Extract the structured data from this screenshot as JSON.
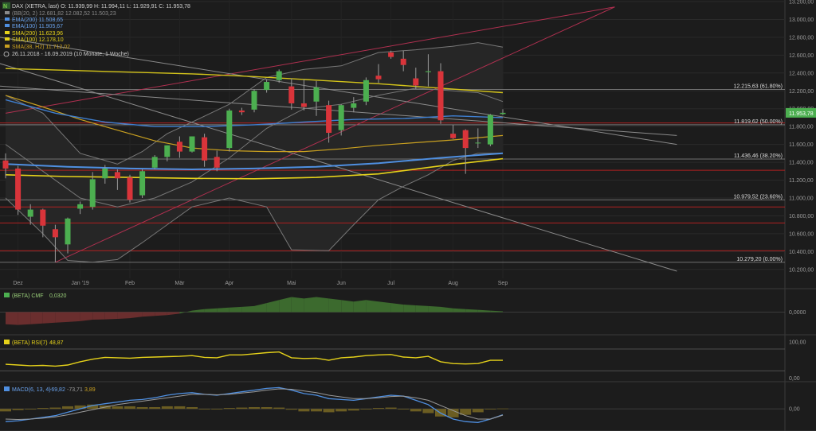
{
  "legend": {
    "title": "DAX (XETRA, last)  O: 11.939,99  H: 11.994,11  L: 11.929,91  C: 11.953,78",
    "items": [
      {
        "label": "(BB(20, 2)  12.681,82  12.082,52  11.503,23",
        "color": "#8a8a8a"
      },
      {
        "label": "EMA(200)  11.508,65",
        "color": "#4f8fe0"
      },
      {
        "label": "EMA(100)  11.905,67",
        "color": "#4f8fe0"
      },
      {
        "label": "SMA(200)  11.623,96",
        "color": "#e6d21a"
      },
      {
        "label": "SMA(100)  12.178,10",
        "color": "#e6d21a"
      },
      {
        "label": "SMA(38, H2)  11.712,02",
        "color": "#c9a020"
      }
    ],
    "period": "26.11.2018 - 16.09.2019  (10 Monate, 1 Woche)",
    "logo_text": "N"
  },
  "chart_data": [
    {
      "type": "candlestick",
      "title": "DAX (XETRA, last)",
      "ylim": [
        10100,
        13200
      ],
      "y_ticks": [
        "13.200,00",
        "13.000,00",
        "12.800,00",
        "12.600,00",
        "12.400,00",
        "12.200,00",
        "12.000,00",
        "11.800,00",
        "11.600,00",
        "11.400,00",
        "11.200,00",
        "11.000,00",
        "10.800,00",
        "10.600,00",
        "10.400,00",
        "10.200,00"
      ],
      "x_ticks": [
        {
          "label": "Dez",
          "week": 1
        },
        {
          "label": "Jan '19",
          "week": 6
        },
        {
          "label": "Feb",
          "week": 10
        },
        {
          "label": "Mär",
          "week": 14
        },
        {
          "label": "Apr",
          "week": 18
        },
        {
          "label": "Mai",
          "week": 23
        },
        {
          "label": "Jun",
          "week": 27
        },
        {
          "label": "Jul",
          "week": 31
        },
        {
          "label": "Aug",
          "week": 36
        },
        {
          "label": "Sep",
          "week": 40
        }
      ],
      "candles": [
        {
          "w": 0,
          "o": 11420,
          "h": 11500,
          "l": 11220,
          "c": 11330
        },
        {
          "w": 1,
          "o": 11330,
          "h": 11360,
          "l": 10810,
          "c": 10870
        },
        {
          "w": 2,
          "o": 10790,
          "h": 10930,
          "l": 10700,
          "c": 10870
        },
        {
          "w": 3,
          "o": 10870,
          "h": 10880,
          "l": 10560,
          "c": 10690
        },
        {
          "w": 4,
          "o": 10650,
          "h": 10700,
          "l": 10280,
          "c": 10560
        },
        {
          "w": 5,
          "o": 10480,
          "h": 10780,
          "l": 10380,
          "c": 10770
        },
        {
          "w": 6,
          "o": 10880,
          "h": 10960,
          "l": 10820,
          "c": 10930
        },
        {
          "w": 7,
          "o": 10900,
          "h": 11290,
          "l": 10870,
          "c": 11210
        },
        {
          "w": 8,
          "o": 11220,
          "h": 11370,
          "l": 11160,
          "c": 11330
        },
        {
          "w": 9,
          "o": 11290,
          "h": 11320,
          "l": 11090,
          "c": 11220
        },
        {
          "w": 10,
          "o": 11230,
          "h": 11260,
          "l": 10950,
          "c": 10980
        },
        {
          "w": 11,
          "o": 11030,
          "h": 11320,
          "l": 11000,
          "c": 11300
        },
        {
          "w": 12,
          "o": 11340,
          "h": 11480,
          "l": 11320,
          "c": 11460
        },
        {
          "w": 13,
          "o": 11460,
          "h": 11590,
          "l": 11410,
          "c": 11590
        },
        {
          "w": 14,
          "o": 11630,
          "h": 11690,
          "l": 11450,
          "c": 11520
        },
        {
          "w": 15,
          "o": 11520,
          "h": 11690,
          "l": 11510,
          "c": 11690
        },
        {
          "w": 16,
          "o": 11680,
          "h": 11720,
          "l": 11350,
          "c": 11420
        },
        {
          "w": 17,
          "o": 11460,
          "h": 11530,
          "l": 11300,
          "c": 11340
        },
        {
          "w": 18,
          "o": 11560,
          "h": 12000,
          "l": 11520,
          "c": 11980
        },
        {
          "w": 19,
          "o": 11980,
          "h": 12010,
          "l": 11930,
          "c": 11960
        },
        {
          "w": 20,
          "o": 11990,
          "h": 12220,
          "l": 11960,
          "c": 12200
        },
        {
          "w": 21,
          "o": 12210,
          "h": 12330,
          "l": 12180,
          "c": 12300
        },
        {
          "w": 22,
          "o": 12320,
          "h": 12440,
          "l": 12290,
          "c": 12420
        },
        {
          "w": 23,
          "o": 12250,
          "h": 12340,
          "l": 11990,
          "c": 12060
        },
        {
          "w": 24,
          "o": 12060,
          "h": 12330,
          "l": 11980,
          "c": 12020
        },
        {
          "w": 25,
          "o": 12080,
          "h": 12310,
          "l": 11920,
          "c": 12240
        },
        {
          "w": 26,
          "o": 12040,
          "h": 12090,
          "l": 11620,
          "c": 11730
        },
        {
          "w": 27,
          "o": 11760,
          "h": 12050,
          "l": 11700,
          "c": 12040
        },
        {
          "w": 28,
          "o": 12010,
          "h": 12130,
          "l": 11960,
          "c": 12060
        },
        {
          "w": 29,
          "o": 12080,
          "h": 12350,
          "l": 12040,
          "c": 12320
        },
        {
          "w": 30,
          "o": 12370,
          "h": 12500,
          "l": 12290,
          "c": 12330
        },
        {
          "w": 31,
          "o": 12630,
          "h": 12650,
          "l": 12560,
          "c": 12580
        },
        {
          "w": 32,
          "o": 12560,
          "h": 12650,
          "l": 12420,
          "c": 12490
        },
        {
          "w": 33,
          "o": 12340,
          "h": 12460,
          "l": 12220,
          "c": 12260
        },
        {
          "w": 34,
          "o": 12410,
          "h": 12610,
          "l": 12250,
          "c": 12420
        },
        {
          "w": 35,
          "o": 12420,
          "h": 12510,
          "l": 11830,
          "c": 11870
        },
        {
          "w": 36,
          "o": 11720,
          "h": 11820,
          "l": 11660,
          "c": 11670
        },
        {
          "w": 37,
          "o": 11760,
          "h": 11770,
          "l": 11270,
          "c": 11560
        },
        {
          "w": 38,
          "o": 11620,
          "h": 11780,
          "l": 11560,
          "c": 11620
        },
        {
          "w": 39,
          "o": 11600,
          "h": 11940,
          "l": 11580,
          "c": 11930
        },
        {
          "w": 40,
          "o": 11940,
          "h": 11994,
          "l": 11930,
          "c": 11954
        }
      ],
      "fibonacci": [
        {
          "value": 12215.63,
          "label": "12.215,63 (61.80%)"
        },
        {
          "value": 11819.62,
          "label": "11.819,62 (50.00%)"
        },
        {
          "value": 11436.46,
          "label": "11.436,46 (38.20%)"
        },
        {
          "value": 10979.52,
          "label": "10.979,52 (23.60%)"
        },
        {
          "value": 10279.2,
          "label": "10.279,20 (0.00%)"
        }
      ],
      "horizontal_lines": [
        11840,
        11310,
        10900,
        10720,
        10410
      ],
      "last_price": {
        "value": 11953.78,
        "label": "11.953,78",
        "color": "#4caf50"
      },
      "sma200": [
        [
          0,
          11260
        ],
        [
          5,
          11240
        ],
        [
          10,
          11230
        ],
        [
          15,
          11220
        ],
        [
          20,
          11215
        ],
        [
          25,
          11230
        ],
        [
          30,
          11270
        ],
        [
          35,
          11360
        ],
        [
          40,
          11440
        ]
      ],
      "ema200": [
        [
          0,
          11380
        ],
        [
          5,
          11350
        ],
        [
          10,
          11330
        ],
        [
          15,
          11320
        ],
        [
          20,
          11330
        ],
        [
          25,
          11350
        ],
        [
          30,
          11390
        ],
        [
          35,
          11450
        ],
        [
          40,
          11500
        ]
      ],
      "ema100": [
        [
          0,
          12100
        ],
        [
          4,
          11950
        ],
        [
          8,
          11850
        ],
        [
          12,
          11800
        ],
        [
          16,
          11800
        ],
        [
          20,
          11820
        ],
        [
          24,
          11850
        ],
        [
          28,
          11880
        ],
        [
          32,
          11890
        ],
        [
          36,
          11920
        ],
        [
          40,
          11900
        ]
      ],
      "sma100": [
        [
          0,
          12450
        ],
        [
          5,
          12430
        ],
        [
          10,
          12410
        ],
        [
          15,
          12390
        ],
        [
          20,
          12360
        ],
        [
          25,
          12320
        ],
        [
          30,
          12280
        ],
        [
          35,
          12230
        ],
        [
          40,
          12180
        ]
      ],
      "sma38": [
        [
          0,
          12150
        ],
        [
          3,
          12020
        ],
        [
          6,
          11880
        ],
        [
          9,
          11760
        ],
        [
          12,
          11640
        ],
        [
          15,
          11560
        ],
        [
          18,
          11530
        ],
        [
          21,
          11520
        ],
        [
          24,
          11520
        ],
        [
          27,
          11550
        ],
        [
          30,
          11590
        ],
        [
          33,
          11620
        ],
        [
          36,
          11650
        ],
        [
          40,
          11700
        ]
      ],
      "bb_upper": [
        [
          0,
          12150
        ],
        [
          3,
          11950
        ],
        [
          6,
          11500
        ],
        [
          9,
          11380
        ],
        [
          11,
          11520
        ],
        [
          13,
          11720
        ],
        [
          15,
          11850
        ],
        [
          18,
          12050
        ],
        [
          21,
          12350
        ],
        [
          24,
          12440
        ],
        [
          27,
          12480
        ],
        [
          30,
          12630
        ],
        [
          33,
          12660
        ],
        [
          36,
          12700
        ],
        [
          38,
          12740
        ],
        [
          40,
          12690
        ]
      ],
      "bb_mid": [
        [
          0,
          11600
        ],
        [
          3,
          11300
        ],
        [
          6,
          11000
        ],
        [
          9,
          10900
        ],
        [
          12,
          11000
        ],
        [
          15,
          11180
        ],
        [
          18,
          11450
        ],
        [
          21,
          11780
        ],
        [
          24,
          12000
        ],
        [
          27,
          12050
        ],
        [
          30,
          12150
        ],
        [
          33,
          12230
        ],
        [
          36,
          12200
        ],
        [
          38,
          12180
        ],
        [
          40,
          12080
        ]
      ],
      "bb_lower": [
        [
          0,
          11000
        ],
        [
          3,
          10600
        ],
        [
          5,
          10300
        ],
        [
          7,
          10280
        ],
        [
          9,
          10310
        ],
        [
          11,
          10500
        ],
        [
          13,
          10700
        ],
        [
          15,
          10900
        ],
        [
          18,
          11000
        ],
        [
          21,
          10900
        ],
        [
          23,
          10420
        ],
        [
          26,
          10410
        ],
        [
          28,
          10700
        ],
        [
          30,
          10980
        ],
        [
          32,
          11130
        ],
        [
          34,
          11260
        ],
        [
          36,
          11420
        ],
        [
          38,
          11500
        ],
        [
          40,
          11500
        ]
      ],
      "trend_lines": [
        {
          "from": [
            0,
            11950
          ],
          "to": [
            49,
            13140
          ],
          "color": "#b03050"
        },
        {
          "from": [
            4,
            10280
          ],
          "to": [
            49,
            13140
          ],
          "color": "#b03050"
        },
        {
          "from": [
            -5,
            12700
          ],
          "to": [
            54,
            10180
          ],
          "color": "#8a8a8a"
        },
        {
          "from": [
            -5,
            12900
          ],
          "to": [
            54,
            11600
          ],
          "color": "#8a8a8a"
        },
        {
          "from": [
            -5,
            12300
          ],
          "to": [
            54,
            11700
          ],
          "color": "#8a8a8a"
        }
      ]
    },
    {
      "type": "area",
      "title": "(BETA) CMF",
      "value_label": "0,0320",
      "ylim": [
        -0.15,
        0.15
      ],
      "y_ticks": [
        "0,0000"
      ],
      "values": [
        -0.08,
        -0.085,
        -0.08,
        -0.075,
        -0.07,
        -0.065,
        -0.06,
        -0.05,
        -0.048,
        -0.045,
        -0.04,
        -0.03,
        -0.025,
        -0.02,
        -0.01,
        0.01,
        0.02,
        0.025,
        0.03,
        0.035,
        0.04,
        0.06,
        0.08,
        0.1,
        0.09,
        0.1,
        0.09,
        0.08,
        0.07,
        0.08,
        0.07,
        0.06,
        0.05,
        0.045,
        0.04,
        0.035,
        0.025,
        0.02,
        0.015,
        0.01,
        0.005
      ]
    },
    {
      "type": "line",
      "title": "(BETA) RSI(7)",
      "value_label": "48,87",
      "ylim": [
        -10,
        115
      ],
      "y_ticks": [
        "100,00",
        "0,00"
      ],
      "levels": [
        80,
        20
      ],
      "values": [
        38,
        36,
        34,
        35,
        33,
        36,
        45,
        52,
        57,
        56,
        55,
        57,
        58,
        59,
        60,
        62,
        57,
        56,
        64,
        64,
        67,
        70,
        72,
        56,
        54,
        55,
        49,
        56,
        58,
        62,
        64,
        65,
        58,
        56,
        60,
        45,
        40,
        39,
        40,
        49,
        49
      ]
    },
    {
      "type": "line",
      "title": "MACD(6, 13, 4)",
      "value_labels": [
        "-69,82",
        "-73,71",
        "3,89"
      ],
      "ylim": [
        -260,
        300
      ],
      "y_ticks": [
        "0,00"
      ],
      "macd": [
        -150,
        -140,
        -120,
        -100,
        -80,
        -40,
        0,
        40,
        60,
        80,
        100,
        110,
        130,
        160,
        180,
        190,
        170,
        160,
        180,
        200,
        220,
        240,
        250,
        220,
        180,
        160,
        120,
        110,
        100,
        120,
        140,
        160,
        150,
        100,
        50,
        -50,
        -120,
        -150,
        -160,
        -120,
        -70
      ],
      "signal": [
        -120,
        -125,
        -120,
        -110,
        -95,
        -70,
        -40,
        -10,
        20,
        50,
        70,
        90,
        110,
        130,
        150,
        170,
        170,
        165,
        170,
        185,
        200,
        220,
        235,
        230,
        210,
        190,
        160,
        140,
        120,
        120,
        130,
        145,
        150,
        130,
        100,
        40,
        -20,
        -80,
        -120,
        -120,
        -74
      ],
      "histogram": [
        -30,
        -15,
        0,
        10,
        15,
        30,
        40,
        50,
        40,
        30,
        30,
        20,
        20,
        30,
        30,
        20,
        0,
        -5,
        10,
        15,
        20,
        20,
        15,
        -10,
        -30,
        -30,
        -40,
        -30,
        -20,
        0,
        10,
        15,
        0,
        -30,
        -50,
        -90,
        -100,
        -70,
        -40,
        0,
        4
      ]
    }
  ]
}
